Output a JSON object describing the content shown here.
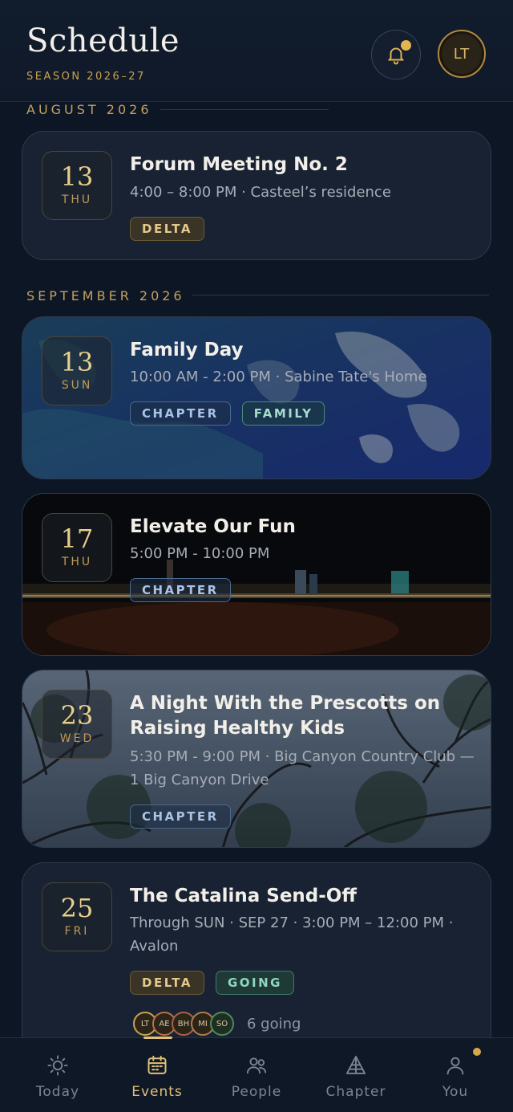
{
  "header": {
    "title": "Schedule",
    "season": "SEASON 2026–27",
    "avatar_initials": "LT"
  },
  "months": [
    {
      "label": "AUGUST 2026"
    },
    {
      "label": "SEPTEMBER 2026"
    }
  ],
  "events": [
    {
      "day": "13",
      "dow": "THU",
      "title": "Forum Meeting No. 2",
      "meta": "4:00 – 8:00 PM · Casteel’s residence",
      "tags": [
        "DELTA"
      ]
    },
    {
      "day": "13",
      "dow": "SUN",
      "title": "Family Day",
      "meta": "10:00 AM - 2:00 PM · Sabine Tate's Home",
      "tags": [
        "CHAPTER",
        "FAMILY"
      ]
    },
    {
      "day": "17",
      "dow": "THU",
      "title": "Elevate Our Fun",
      "meta": "5:00 PM - 10:00 PM",
      "tags": [
        "CHAPTER"
      ]
    },
    {
      "day": "23",
      "dow": "WED",
      "title": "A Night With the Prescotts on Raising Healthy Kids",
      "meta": "5:30 PM - 9:00 PM · Big Canyon Country Club — 1 Big Canyon Drive",
      "tags": [
        "CHAPTER"
      ]
    },
    {
      "day": "25",
      "dow": "FRI",
      "title": "The Catalina Send-Off",
      "meta": "Through SUN · SEP 27 · 3:00 PM – 12:00 PM · Avalon",
      "tags": [
        "DELTA",
        "GOING"
      ],
      "attendees": [
        "LT",
        "AE",
        "BH",
        "MI",
        "SO"
      ],
      "going": "6 going"
    }
  ],
  "tabs": [
    {
      "label": "Today",
      "icon": "sun-icon"
    },
    {
      "label": "Events",
      "icon": "calendar-icon"
    },
    {
      "label": "People",
      "icon": "people-icon"
    },
    {
      "label": "Chapter",
      "icon": "chapter-icon"
    },
    {
      "label": "You",
      "icon": "user-icon"
    }
  ],
  "colors": {
    "accent": "#e0c078",
    "background": "#0d1624"
  }
}
